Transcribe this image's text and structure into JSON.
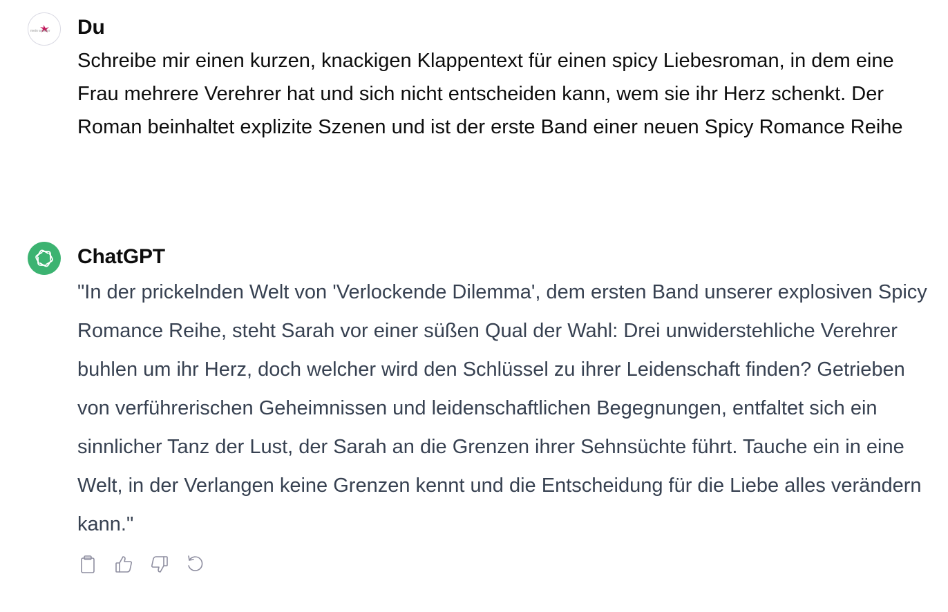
{
  "conversation": {
    "user": {
      "name": "Du",
      "avatar_icon": "user-logo-icon",
      "avatar_text": "mein wunder",
      "message": "Schreibe mir einen kurzen, knackigen Klappentext für einen spicy Liebesroman, in dem eine Frau mehrere Verehrer hat und sich nicht entscheiden kann, wem sie ihr Herz schenkt. Der Roman beinhaltet explizite Szenen und ist der erste Band einer neuen Spicy Romance Reihe"
    },
    "assistant": {
      "name": "ChatGPT",
      "avatar_icon": "openai-logo-icon",
      "message": "\"In der prickelnden Welt von 'Verlockende Dilemma', dem ersten Band unserer explosiven Spicy Romance Reihe, steht Sarah vor einer süßen Qual der Wahl: Drei unwiderstehliche Verehrer buhlen um ihr Herz, doch welcher wird den Schlüssel zu ihrer Leidenschaft finden? Getrieben von verführerischen Geheimnissen und leidenschaftlichen Begegnungen, entfaltet sich ein sinnlicher Tanz der Lust, der Sarah an die Grenzen ihrer Sehnsüchte führt. Tauche ein in eine Welt, in der Verlangen keine Grenzen kennt und die Entscheidung für die Liebe alles verändern kann.\""
    },
    "actions": [
      {
        "icon": "clipboard-icon"
      },
      {
        "icon": "thumbs-up-icon"
      },
      {
        "icon": "thumbs-down-icon"
      },
      {
        "icon": "regenerate-icon"
      }
    ]
  },
  "colors": {
    "assistant_avatar_bg": "#3cb371",
    "user_text": "#0d0d0d",
    "assistant_text": "#374151",
    "icon_gray": "#8e8ea0",
    "logo_pink": "#c2185b"
  }
}
